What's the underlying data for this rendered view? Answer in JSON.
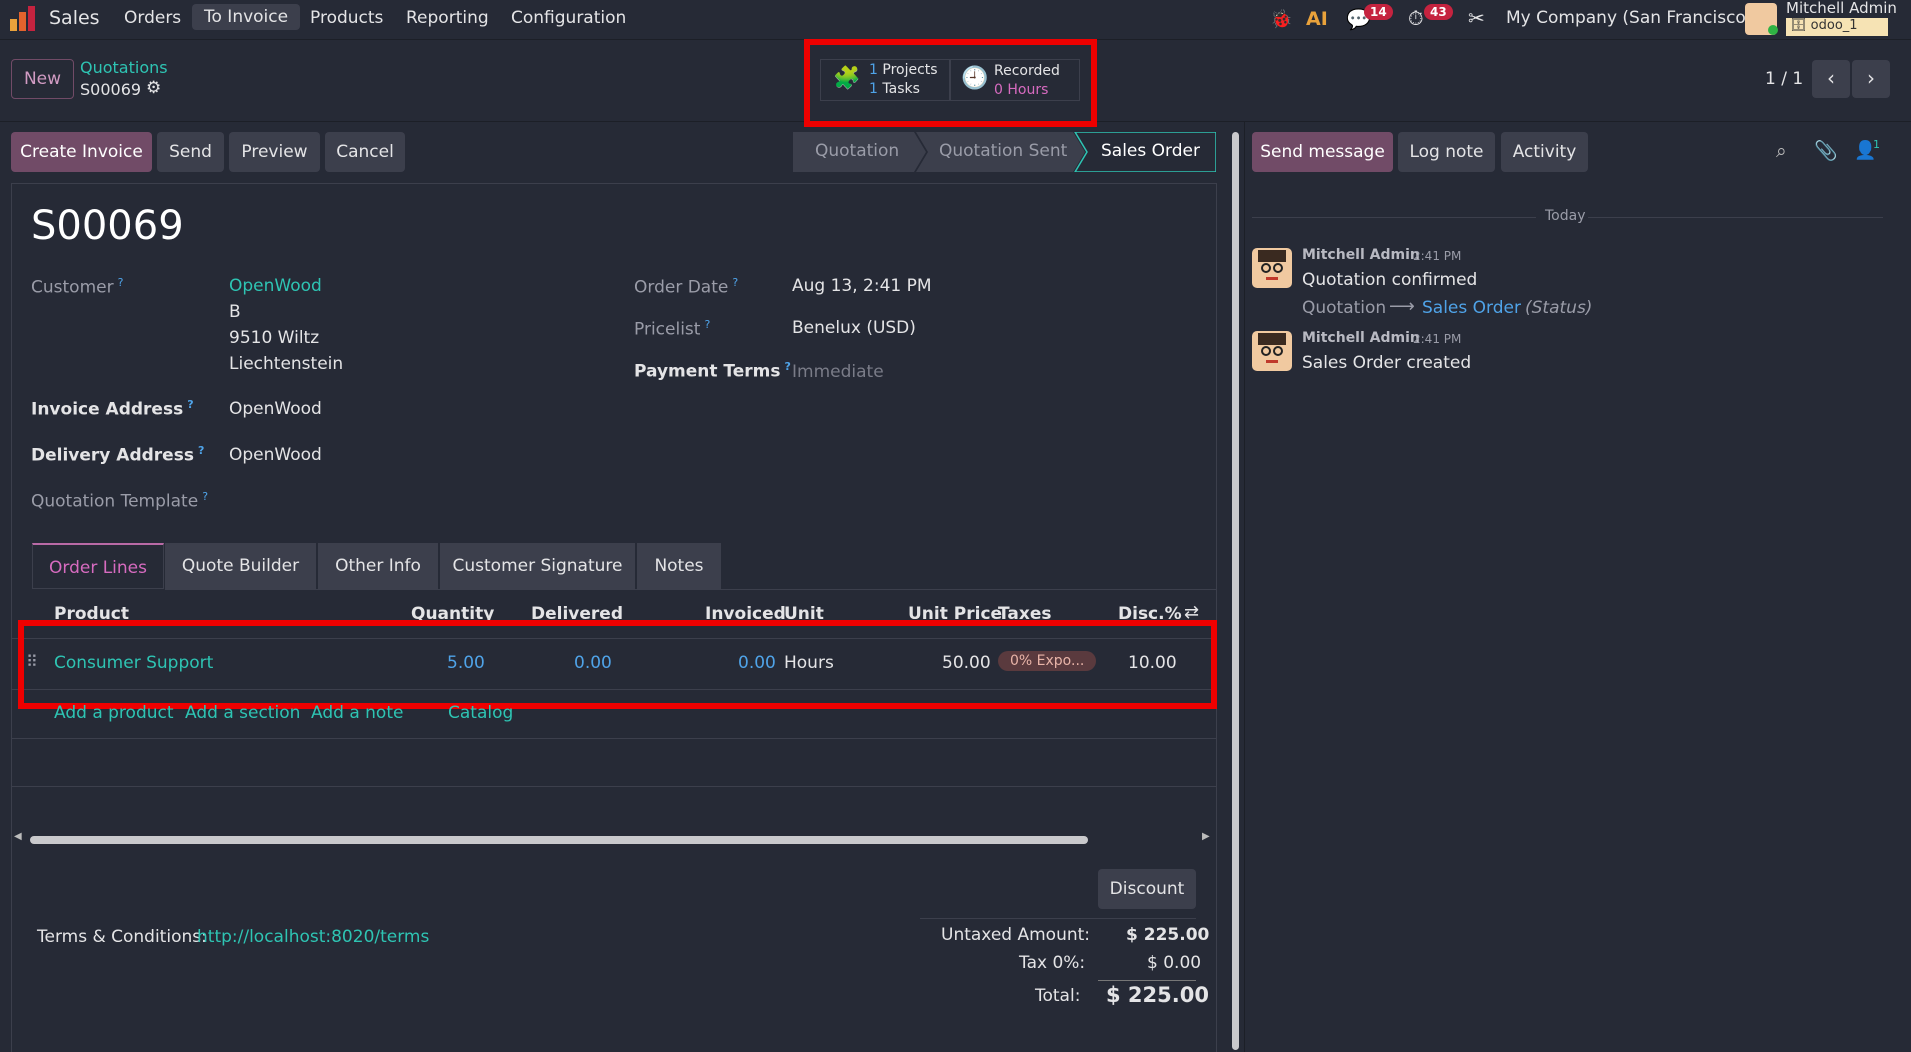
{
  "navbar": {
    "app_name": "Sales",
    "menu": [
      "Orders",
      "To Invoice",
      "Products",
      "Reporting",
      "Configuration"
    ],
    "messages_count": "14",
    "activities_count": "43",
    "company": "My Company (San Francisco)",
    "user_name": "Mitchell Admin",
    "db_name": "odoo_1"
  },
  "control": {
    "new_label": "New",
    "breadcrumb_parent": "Quotations",
    "record_name": "S00069",
    "pager": "1 / 1",
    "smart_projects_count": "1",
    "smart_projects_label": "Projects",
    "smart_tasks_count": "1",
    "smart_tasks_label": "Tasks",
    "smart_recorded_label": "Recorded",
    "smart_recorded_value": "0 Hours"
  },
  "actions": {
    "create_invoice": "Create Invoice",
    "send": "Send",
    "preview": "Preview",
    "cancel": "Cancel"
  },
  "statusbar": [
    "Quotation",
    "Quotation Sent",
    "Sales Order"
  ],
  "form": {
    "title": "S00069",
    "customer_label": "Customer",
    "customer_name": "OpenWood",
    "customer_line1": "B",
    "customer_line2": "9510 Wiltz",
    "customer_line3": "Liechtenstein",
    "invoice_address_label": "Invoice Address",
    "invoice_address": "OpenWood",
    "delivery_address_label": "Delivery Address",
    "delivery_address": "OpenWood",
    "template_label": "Quotation Template",
    "order_date_label": "Order Date",
    "order_date": "Aug 13, 2:41 PM",
    "pricelist_label": "Pricelist",
    "pricelist": "Benelux (USD)",
    "payment_terms_label": "Payment Terms",
    "payment_terms_placeholder": "Immediate"
  },
  "tabs": [
    "Order Lines",
    "Quote Builder",
    "Other Info",
    "Customer Signature",
    "Notes"
  ],
  "order_lines": {
    "headers": [
      "Product",
      "Quantity",
      "Delivered",
      "Invoiced",
      "Unit",
      "Unit Price",
      "Taxes",
      "Disc.%"
    ],
    "rows": [
      {
        "product": "Consumer Support",
        "quantity": "5.00",
        "delivered": "0.00",
        "invoiced": "0.00",
        "unit": "Hours",
        "unit_price": "50.00",
        "taxes": "0% Expo...",
        "discount": "10.00"
      }
    ],
    "add_product": "Add a product",
    "add_section": "Add a section",
    "add_note": "Add a note",
    "catalog": "Catalog"
  },
  "footer": {
    "discount_button": "Discount",
    "terms_label": "Terms & Conditions:",
    "terms_link": "http://localhost:8020/terms",
    "untaxed_label": "Untaxed Amount:",
    "untaxed_value": "$ 225.00",
    "tax_label": "Tax 0%:",
    "tax_value": "$ 0.00",
    "total_label": "Total:",
    "total_value": "$ 225.00"
  },
  "chatter": {
    "send_message": "Send message",
    "log_note": "Log note",
    "activity": "Activity",
    "followers_count": "1",
    "date_separator": "Today",
    "messages": [
      {
        "author": "Mitchell Admin",
        "time": "2:41 PM",
        "body": "Quotation confirmed",
        "track_from": "Quotation",
        "track_to": "Sales Order",
        "track_field": "(Status)"
      },
      {
        "author": "Mitchell Admin",
        "time": "2:41 PM",
        "body": "Sales Order created"
      }
    ]
  },
  "colors": {
    "primary": "#714b67",
    "accent": "#2ec4b3",
    "link_blue": "#4fa3e8",
    "highlight": "#ee0000"
  }
}
